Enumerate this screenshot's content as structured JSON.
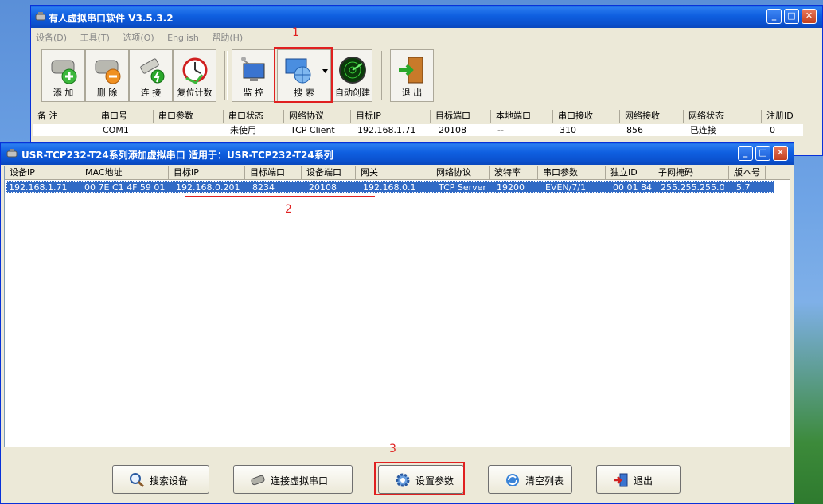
{
  "main_window": {
    "title": "有人虚拟串口软件 V3.5.3.2",
    "menu": [
      "设备(D)",
      "工具(T)",
      "选项(O)",
      "English",
      "帮助(H)"
    ],
    "toolbar": {
      "add": "添 加",
      "delete": "删 除",
      "connect": "连 接",
      "reset_count": "复位计数",
      "monitor": "监 控",
      "search": "搜 索",
      "auto_create": "自动创建",
      "exit": "退 出"
    },
    "table": {
      "headers": [
        "备 注",
        "串口号",
        "串口参数",
        "串口状态",
        "网络协议",
        "目标IP",
        "目标端口",
        "本地端口",
        "串口接收",
        "网络接收",
        "网络状态",
        "注册ID"
      ],
      "row": [
        "",
        "COM1",
        "",
        "未使用",
        "TCP Client",
        "192.168.1.71",
        "20108",
        "--",
        "310",
        "856",
        "已连接",
        "0"
      ]
    }
  },
  "dialog": {
    "title": "USR-TCP232-T24系列添加虚拟串口   适用于：USR-TCP232-T24系列",
    "table": {
      "headers": [
        "设备IP",
        "MAC地址",
        "目标IP",
        "目标端口",
        "设备端口",
        "网关",
        "网络协议",
        "波特率",
        "串口参数",
        "独立ID",
        "子网掩码",
        "版本号"
      ],
      "row": [
        "192.168.1.71",
        "00 7E C1 4F 59 01",
        "192.168.0.201",
        "8234",
        "20108",
        "192.168.0.1",
        "TCP Server",
        "19200",
        "EVEN/7/1",
        "00 01 84",
        "255.255.255.0",
        "5.7"
      ]
    },
    "buttons": {
      "search_device": "搜索设备",
      "connect_virtual": "连接虚拟串口",
      "set_params": "设置参数",
      "clear_list": "清空列表",
      "exit": "退出"
    }
  },
  "annotations": {
    "a1": "1",
    "a2": "2",
    "a3": "3"
  },
  "colors": {
    "annotation": "#e02020",
    "selection": "#316ac5",
    "title_bar": "#0b52cf"
  }
}
